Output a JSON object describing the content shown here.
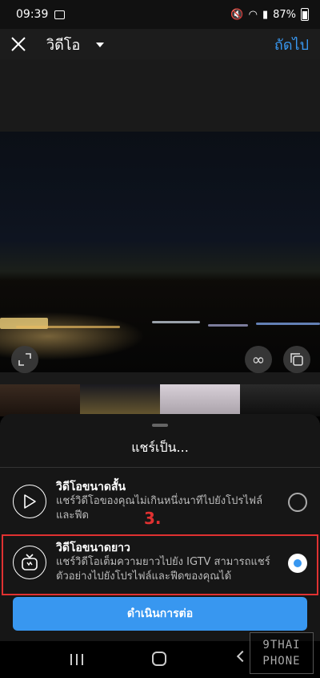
{
  "status_bar": {
    "time": "09:39",
    "battery": "87%"
  },
  "header": {
    "title": "วิดีโอ",
    "next_label": "ถัดไป"
  },
  "sheet": {
    "title": "แชร์เป็น...",
    "options": [
      {
        "label": "วิดีโอขนาดสั้น",
        "description": "แชร์วิดีโอของคุณไม่เกินหนึ่งนาทีไปยังโปรไฟล์และฟีด",
        "selected": false
      },
      {
        "label": "วิดีโอขนาดยาว",
        "description": "แชร์วิดีโอเต็มความยาวไปยัง IGTV สามารถแชร์ตัวอย่างไปยังโปรไฟล์และฟีดของคุณได้",
        "selected": true
      }
    ],
    "step_marker": "3.",
    "continue_label": "ดำเนินการต่อ"
  },
  "watermark": {
    "line1": "9THAI",
    "line2": "PHONE"
  },
  "colors": {
    "accent": "#3897f0",
    "highlight": "#e03131",
    "sheet_bg": "#161616"
  },
  "icons": [
    "close-icon",
    "chevron-down-icon",
    "expand-icon",
    "loop-icon",
    "multi-select-icon",
    "play-icon",
    "igtv-icon"
  ]
}
